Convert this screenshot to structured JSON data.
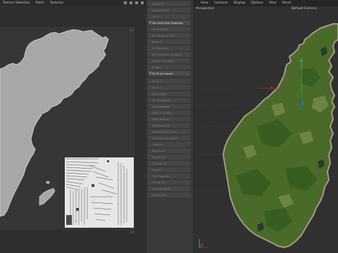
{
  "uv_menu": {
    "items": [
      "Texture Selection",
      "Patch",
      "Textures"
    ]
  },
  "viewport_menu": {
    "items": [
      "View",
      "Cameras",
      "Display",
      "Options",
      "Filter",
      "Panel"
    ]
  },
  "viewport": {
    "name": "Perspective",
    "camera": "Default Camera"
  },
  "command_panel": {
    "items": [
      {
        "label": "Relax UV",
        "active": false,
        "icon": "none"
      },
      {
        "label": "Normalize UV",
        "active": false,
        "icon": "none"
      },
      {
        "label": "Fit UV",
        "active": false,
        "icon": "none"
      },
      {
        "label": "Set UVW from Projection",
        "active": true,
        "icon": "cross-icon"
      },
      {
        "label": "UV Mapping",
        "active": false,
        "icon": "none"
      },
      {
        "label": "Fit Canvas to UVs",
        "active": false,
        "icon": "none"
      },
      {
        "label": "Mirror U",
        "active": false,
        "icon": "none"
      },
      {
        "label": "Fit Sequence",
        "active": false,
        "icon": "none"
      },
      {
        "label": "Sort Selection Mapping",
        "active": false,
        "icon": "none"
      },
      {
        "label": "Terrain Transform",
        "active": false,
        "icon": "none"
      },
      {
        "label": "Project",
        "active": false,
        "icon": "none"
      },
      {
        "label": "Fit UV to Canvas",
        "active": true,
        "icon": "cross-icon"
      },
      {
        "label": "Mirror U",
        "active": false,
        "icon": "none"
      },
      {
        "label": "Mirror V",
        "active": false,
        "icon": "none"
      },
      {
        "label": "Grid Layout",
        "active": false,
        "icon": "none"
      },
      {
        "label": "UV Triangulate",
        "active": false,
        "icon": "none"
      },
      {
        "label": "UV Relaxation",
        "active": false,
        "icon": "none"
      },
      {
        "label": "Pack UV Islands",
        "active": false,
        "icon": "none"
      },
      {
        "label": "Stack Islands",
        "active": false,
        "icon": "none"
      },
      {
        "label": "Straighten UV",
        "active": false,
        "icon": "none"
      },
      {
        "label": "Normalize UV Scale",
        "active": false,
        "icon": "none"
      },
      {
        "label": "Optimize UV Layout",
        "active": false,
        "icon": "none"
      },
      {
        "label": "Cube UV",
        "active": false,
        "icon": "none"
      },
      {
        "label": "Sphere UV",
        "active": false,
        "icon": "none"
      },
      {
        "label": "Planar UV",
        "active": false,
        "icon": "none"
      },
      {
        "label": "Cylinder UV",
        "active": false,
        "icon": "none"
      },
      {
        "label": "Flat UV",
        "active": false,
        "icon": "none"
      },
      {
        "label": "Tile Projection",
        "active": false,
        "icon": "none"
      },
      {
        "label": "Frontal UV",
        "active": false,
        "icon": "none"
      },
      {
        "label": "Shrinkwrap UV",
        "active": false,
        "icon": "none"
      },
      {
        "label": "Terrain UV",
        "active": false,
        "icon": "none"
      }
    ]
  },
  "colors": {
    "terrain_green": "#4a6a2a",
    "terrain_edge": "#a89888",
    "uv_fill": "#a8a8a8",
    "texture_fill": "#e6e6e6",
    "panel_bg": "#3a3a3a",
    "highlight": "#4b4b4b",
    "axis_red": "#d02020",
    "axis_green": "#20c050",
    "axis_blue": "#2080d0"
  }
}
